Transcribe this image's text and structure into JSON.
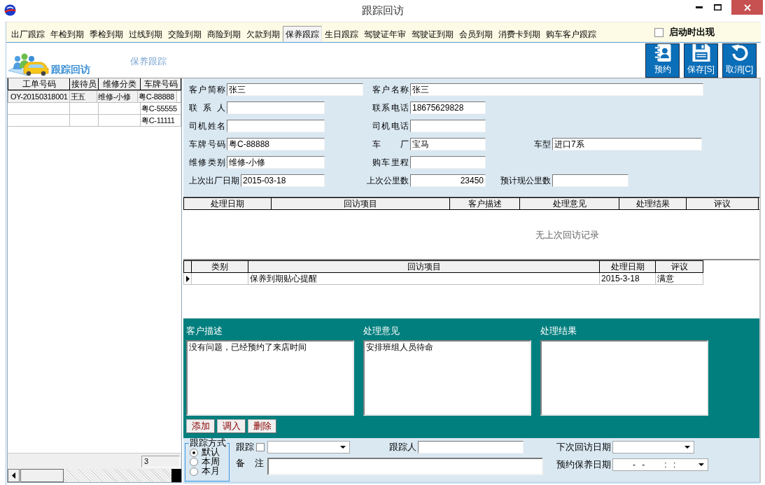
{
  "window": {
    "title": "跟踪回访"
  },
  "tabs": [
    {
      "label": "出厂跟踪",
      "selected": false
    },
    {
      "label": "年检到期",
      "selected": false
    },
    {
      "label": "季检到期",
      "selected": false
    },
    {
      "label": "过线到期",
      "selected": false
    },
    {
      "label": "交险到期",
      "selected": false
    },
    {
      "label": "商险到期",
      "selected": false
    },
    {
      "label": "欠款到期",
      "selected": false
    },
    {
      "label": "保养跟踪",
      "selected": true
    },
    {
      "label": "生日跟踪",
      "selected": false
    },
    {
      "label": "驾驶证年审",
      "selected": false
    },
    {
      "label": "驾驶证到期",
      "selected": false
    },
    {
      "label": "会员到期",
      "selected": false
    },
    {
      "label": "消费卡到期",
      "selected": false
    },
    {
      "label": "购车客户跟踪",
      "selected": false
    }
  ],
  "startup_checkbox": {
    "label": "启动时出现",
    "checked": false
  },
  "header": {
    "logo_text": "跟踪回访",
    "section_title": "保养跟踪"
  },
  "toolbar": [
    {
      "label": "预约",
      "kind": "appointment"
    },
    {
      "label": "保存[S]",
      "kind": "save"
    },
    {
      "label": "取消[C]",
      "kind": "cancel"
    }
  ],
  "order_list": {
    "columns": [
      "工单号码",
      "接待员",
      "维修分类",
      "车牌号码"
    ],
    "rows": [
      {
        "cells": [
          "OY-20150318001",
          "王五",
          "维修-小修",
          "粤C-88888"
        ],
        "selected": true
      },
      {
        "cells": [
          null,
          null,
          null,
          "粤C-55555"
        ],
        "selected": false
      },
      {
        "cells": [
          null,
          null,
          null,
          "粤C-11111"
        ],
        "selected": false
      }
    ],
    "record_count": "3"
  },
  "customer_form": {
    "rows": [
      [
        {
          "label": "客户简称",
          "value": "张三"
        },
        {
          "label": "客户名称",
          "value": "张三"
        }
      ],
      [
        {
          "label": "联 系 人"
        },
        {
          "label": "联系电话",
          "value": "18675629828"
        }
      ],
      [
        {
          "label": "司机姓名"
        },
        {
          "label": "司机电话"
        }
      ],
      [
        {
          "label": "车牌号码",
          "value": "粤C-88888"
        },
        {
          "label": "车 厂",
          "value": "宝马"
        },
        {
          "label": "车型",
          "value": "进口7系"
        }
      ],
      [
        {
          "label": "维修类别",
          "value": "维修-小修"
        },
        {
          "label": "购车里程"
        }
      ],
      [
        {
          "label": "上次出厂日期",
          "value": "2015-03-18"
        },
        {
          "label": "上次公里数",
          "value": "23450"
        },
        {
          "label": "预计现公里数"
        }
      ]
    ]
  },
  "history_table": {
    "columns": [
      "处理日期",
      "回访项目",
      "客户描述",
      "处理意见",
      "处理结果",
      "评议"
    ],
    "empty_message": "无上次回访记录"
  },
  "visit_items": {
    "columns": [
      "类别",
      "回访项目",
      "处理日期",
      "评议"
    ],
    "rows": [
      {
        "cells": [
          null,
          "保养到期贴心提醒",
          "2015-3-18",
          "满意"
        ],
        "selected": true
      }
    ]
  },
  "notes": [
    {
      "label": "客户描述",
      "value": "没有问题，已经预约了来店时间"
    },
    {
      "label": "处理意见",
      "value": "安排班组人员待命"
    },
    {
      "label": "处理结果"
    }
  ],
  "note_buttons": [
    "添加",
    "调入",
    "删除"
  ],
  "tracking": {
    "mode_label": "跟踪方式",
    "modes": [
      {
        "label": "默认",
        "selected": true
      },
      {
        "label": "本周",
        "selected": false
      },
      {
        "label": "本月",
        "selected": false
      }
    ],
    "track_checkbox": {
      "label": "跟踪",
      "checked": false
    },
    "tracker_label": "跟踪人",
    "remark_label": "备 注",
    "next_visit_label": "下次回访日期",
    "maintenance_date": {
      "label": "预约保养日期",
      "value": "- -   : :"
    }
  }
}
